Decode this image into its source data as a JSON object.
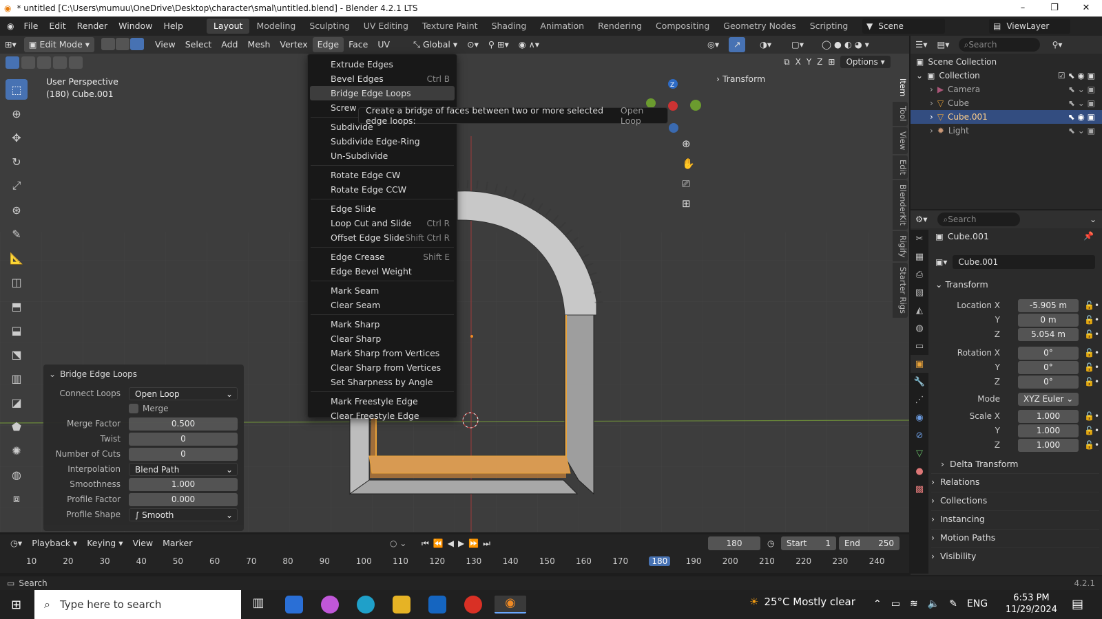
{
  "titlebar": {
    "title": "* untitled [C:\\Users\\mumuu\\OneDrive\\Desktop\\character\\smal\\untitled.blend] - Blender 4.2.1 LTS"
  },
  "menubar": {
    "menus": [
      "File",
      "Edit",
      "Render",
      "Window",
      "Help"
    ],
    "workspaces": [
      "Layout",
      "Modeling",
      "Sculpting",
      "UV Editing",
      "Texture Paint",
      "Shading",
      "Animation",
      "Rendering",
      "Compositing",
      "Geometry Nodes",
      "Scripting"
    ],
    "active_workspace": "Layout",
    "scene": "Scene",
    "view_layer": "ViewLayer"
  },
  "header": {
    "mode": "Edit Mode",
    "menus": [
      "View",
      "Select",
      "Add",
      "Mesh",
      "Vertex",
      "Edge",
      "Face",
      "UV"
    ],
    "transform_orientation": "Global",
    "axes": [
      "X",
      "Y",
      "Z"
    ],
    "options": "Options"
  },
  "viewport": {
    "line1": "User Perspective",
    "line2": "(180) Cube.001",
    "panel_transform": "Transform"
  },
  "edge_menu": {
    "items": [
      {
        "label": "Extrude Edges",
        "shortcut": ""
      },
      {
        "label": "Bevel Edges",
        "shortcut": "Ctrl B"
      },
      {
        "label": "Bridge Edge Loops",
        "shortcut": ""
      },
      {
        "label": "Screw",
        "shortcut": ""
      },
      {
        "label": "Subdivide",
        "shortcut": ""
      },
      {
        "label": "Subdivide Edge-Ring",
        "shortcut": ""
      },
      {
        "label": "Un-Subdivide",
        "shortcut": ""
      },
      {
        "label": "Rotate Edge CW",
        "shortcut": ""
      },
      {
        "label": "Rotate Edge CCW",
        "shortcut": ""
      },
      {
        "label": "Edge Slide",
        "shortcut": ""
      },
      {
        "label": "Loop Cut and Slide",
        "shortcut": "Ctrl R"
      },
      {
        "label": "Offset Edge Slide",
        "shortcut": "Shift Ctrl R"
      },
      {
        "label": "Edge Crease",
        "shortcut": "Shift E"
      },
      {
        "label": "Edge Bevel Weight",
        "shortcut": ""
      },
      {
        "label": "Mark Seam",
        "shortcut": ""
      },
      {
        "label": "Clear Seam",
        "shortcut": ""
      },
      {
        "label": "Mark Sharp",
        "shortcut": ""
      },
      {
        "label": "Clear Sharp",
        "shortcut": ""
      },
      {
        "label": "Mark Sharp from Vertices",
        "shortcut": ""
      },
      {
        "label": "Clear Sharp from Vertices",
        "shortcut": ""
      },
      {
        "label": "Set Sharpness by Angle",
        "shortcut": ""
      },
      {
        "label": "Mark Freestyle Edge",
        "shortcut": ""
      },
      {
        "label": "Clear Freestyle Edge",
        "shortcut": ""
      }
    ],
    "tooltip": "Create a bridge of faces between two or more selected edge loops:",
    "tooltip_python": "Open Loop"
  },
  "operator_panel": {
    "title": "Bridge Edge Loops",
    "connect_loops_label": "Connect Loops",
    "connect_loops": "Open Loop",
    "merge_label": "Merge",
    "merge_factor_label": "Merge Factor",
    "merge_factor": "0.500",
    "twist_label": "Twist",
    "twist": "0",
    "cuts_label": "Number of Cuts",
    "cuts": "0",
    "interp_label": "Interpolation",
    "interp": "Blend Path",
    "smooth_label": "Smoothness",
    "smooth": "1.000",
    "pfactor_label": "Profile Factor",
    "pfactor": "0.000",
    "pshape_label": "Profile Shape",
    "pshape": "Smooth"
  },
  "timeline": {
    "menus": [
      "Playback",
      "Keying",
      "View",
      "Marker"
    ],
    "current": "180",
    "start_label": "Start",
    "start": "1",
    "end_label": "End",
    "end": "250",
    "ticks": [
      "10",
      "20",
      "30",
      "40",
      "50",
      "60",
      "70",
      "80",
      "90",
      "100",
      "110",
      "120",
      "130",
      "140",
      "150",
      "160",
      "170",
      "180",
      "190",
      "200",
      "210",
      "220",
      "230",
      "240"
    ]
  },
  "statusbar": {
    "left": "Search",
    "version": "4.2.1"
  },
  "outliner": {
    "search": "Search",
    "root": "Scene Collection",
    "collection": "Collection",
    "items": [
      "Camera",
      "Cube",
      "Cube.001",
      "Light"
    ],
    "active": "Cube.001"
  },
  "properties": {
    "search": "Search",
    "object": "Cube.001",
    "object_name_field": "Cube.001",
    "transform": "Transform",
    "loc_label": "Location X",
    "loc_x": "-5.905 m",
    "loc_y": "0 m",
    "loc_z": "5.054 m",
    "rot_label": "Rotation X",
    "rot_x": "0°",
    "rot_y": "0°",
    "rot_z": "0°",
    "mode_label": "Mode",
    "mode": "XYZ Euler",
    "scale_label": "Scale X",
    "scale_x": "1.000",
    "scale_y": "1.000",
    "scale_z": "1.000",
    "y_label": "Y",
    "z_label": "Z",
    "sections": [
      "Delta Transform",
      "Relations",
      "Collections",
      "Instancing",
      "Motion Paths",
      "Visibility"
    ]
  },
  "side_tabs": [
    "Item",
    "Tool",
    "View",
    "Edit",
    "BlenderKit",
    "Rigify",
    "Starter Rigs"
  ],
  "taskbar": {
    "search": "Type here to search",
    "weather": "25°C  Mostly clear",
    "lang": "ENG",
    "time": "6:53 PM",
    "date": "11/29/2024"
  },
  "colors": {
    "accent": "#4772b3",
    "selection": "#e8a23a",
    "menu_bg": "#181818"
  }
}
